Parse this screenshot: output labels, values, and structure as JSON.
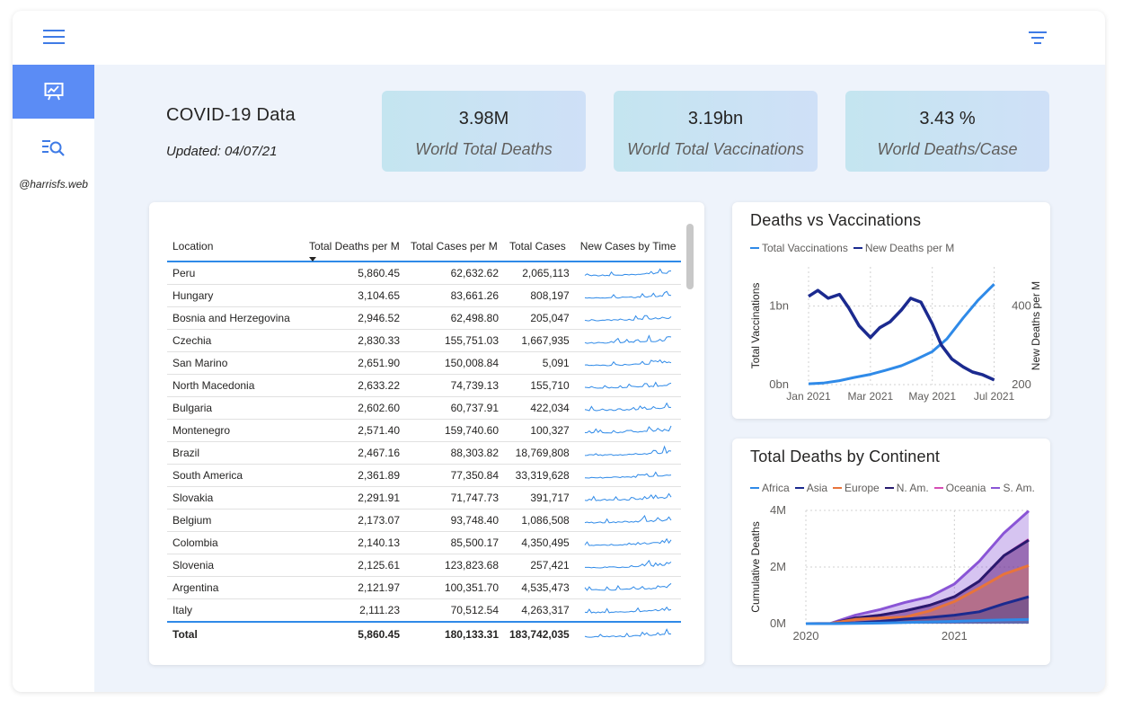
{
  "sidebar": {
    "handle": "@harrisfs.web"
  },
  "header": {
    "title": "COVID-19 Data",
    "updated": "Updated: 04/07/21"
  },
  "kpis": [
    {
      "value": "3.98M",
      "label": "World Total Deaths"
    },
    {
      "value": "3.19bn",
      "label": "World Total Vaccinations"
    },
    {
      "value": "3.43 %",
      "label": "World Deaths/Case"
    }
  ],
  "table": {
    "headers": [
      "Location",
      "Total Deaths per M",
      "Total Cases per M",
      "Total Cases",
      "New Cases by Time"
    ],
    "rows": [
      {
        "location": "Peru",
        "deaths_per_m": "5,860.45",
        "cases_per_m": "62,632.62",
        "total_cases": "2,065,113"
      },
      {
        "location": "Hungary",
        "deaths_per_m": "3,104.65",
        "cases_per_m": "83,661.26",
        "total_cases": "808,197"
      },
      {
        "location": "Bosnia and Herzegovina",
        "deaths_per_m": "2,946.52",
        "cases_per_m": "62,498.80",
        "total_cases": "205,047"
      },
      {
        "location": "Czechia",
        "deaths_per_m": "2,830.33",
        "cases_per_m": "155,751.03",
        "total_cases": "1,667,935"
      },
      {
        "location": "San Marino",
        "deaths_per_m": "2,651.90",
        "cases_per_m": "150,008.84",
        "total_cases": "5,091"
      },
      {
        "location": "North Macedonia",
        "deaths_per_m": "2,633.22",
        "cases_per_m": "74,739.13",
        "total_cases": "155,710"
      },
      {
        "location": "Bulgaria",
        "deaths_per_m": "2,602.60",
        "cases_per_m": "60,737.91",
        "total_cases": "422,034"
      },
      {
        "location": "Montenegro",
        "deaths_per_m": "2,571.40",
        "cases_per_m": "159,740.60",
        "total_cases": "100,327"
      },
      {
        "location": "Brazil",
        "deaths_per_m": "2,467.16",
        "cases_per_m": "88,303.82",
        "total_cases": "18,769,808"
      },
      {
        "location": "South America",
        "deaths_per_m": "2,361.89",
        "cases_per_m": "77,350.84",
        "total_cases": "33,319,628"
      },
      {
        "location": "Slovakia",
        "deaths_per_m": "2,291.91",
        "cases_per_m": "71,747.73",
        "total_cases": "391,717"
      },
      {
        "location": "Belgium",
        "deaths_per_m": "2,173.07",
        "cases_per_m": "93,748.40",
        "total_cases": "1,086,508"
      },
      {
        "location": "Colombia",
        "deaths_per_m": "2,140.13",
        "cases_per_m": "85,500.17",
        "total_cases": "4,350,495"
      },
      {
        "location": "Slovenia",
        "deaths_per_m": "2,125.61",
        "cases_per_m": "123,823.68",
        "total_cases": "257,421"
      },
      {
        "location": "Argentina",
        "deaths_per_m": "2,121.97",
        "cases_per_m": "100,351.70",
        "total_cases": "4,535,473"
      },
      {
        "location": "Italy",
        "deaths_per_m": "2,111.23",
        "cases_per_m": "70,512.54",
        "total_cases": "4,263,317"
      }
    ],
    "total": {
      "label": "Total",
      "deaths_per_m": "5,860.45",
      "cases_per_m": "180,133.31",
      "total_cases": "183,742,035"
    },
    "sparkline_color": "#2f8ae8"
  },
  "chart_data": [
    {
      "type": "line",
      "title": "Deaths vs Vaccinations",
      "series": [
        {
          "name": "Total Vaccinations",
          "color": "#2f8ae8",
          "axis": "left",
          "unit": "bn",
          "x": [
            "2021-01-01",
            "2021-01-15",
            "2021-02-01",
            "2021-02-15",
            "2021-03-01",
            "2021-03-15",
            "2021-04-01",
            "2021-04-15",
            "2021-05-01",
            "2021-05-15",
            "2021-06-01",
            "2021-06-15",
            "2021-07-01"
          ],
          "values": [
            0.01,
            0.02,
            0.05,
            0.09,
            0.13,
            0.18,
            0.24,
            0.32,
            0.42,
            0.58,
            0.85,
            1.07,
            1.28
          ]
        },
        {
          "name": "New Deaths per M",
          "color": "#1b2a8f",
          "axis": "right",
          "x": [
            "2021-01-01",
            "2021-01-10",
            "2021-01-20",
            "2021-02-01",
            "2021-02-10",
            "2021-02-20",
            "2021-03-01",
            "2021-03-10",
            "2021-03-20",
            "2021-04-01",
            "2021-04-10",
            "2021-04-20",
            "2021-05-01",
            "2021-05-10",
            "2021-05-20",
            "2021-06-01",
            "2021-06-10",
            "2021-06-20",
            "2021-07-01"
          ],
          "values": [
            425,
            440,
            420,
            430,
            395,
            350,
            320,
            345,
            360,
            390,
            420,
            410,
            355,
            300,
            265,
            245,
            232,
            225,
            212
          ]
        }
      ],
      "x_ticks": [
        "Jan 2021",
        "Mar 2021",
        "May 2021",
        "Jul 2021"
      ],
      "legend": [
        "Total Vaccinations",
        "New Deaths per M"
      ],
      "ylabel_left": "Total Vaccinations",
      "ylabel_right": "New Deaths per M",
      "ylim_left": [
        0,
        1.5
      ],
      "yticks_left": [
        "0bn",
        "1bn"
      ],
      "ylim_right": [
        200,
        500
      ],
      "yticks_right": [
        "200",
        "400"
      ],
      "legend_position": "top-left",
      "grid": true
    },
    {
      "type": "area",
      "title": "Total Deaths by Continent",
      "x": [
        "2020-01",
        "2020-03",
        "2020-05",
        "2020-07",
        "2020-09",
        "2020-11",
        "2021-01",
        "2021-03",
        "2021-05",
        "2021-07"
      ],
      "series": [
        {
          "name": "Africa",
          "color": "#2f8ae8",
          "values": [
            0,
            0,
            0.005,
            0.02,
            0.04,
            0.06,
            0.08,
            0.11,
            0.13,
            0.15
          ]
        },
        {
          "name": "Asia",
          "color": "#1b2a8f",
          "values": [
            0,
            0,
            0.03,
            0.08,
            0.16,
            0.22,
            0.3,
            0.42,
            0.7,
            0.95
          ]
        },
        {
          "name": "Europe",
          "color": "#e8743b",
          "values": [
            0,
            0.01,
            0.15,
            0.2,
            0.23,
            0.45,
            0.78,
            1.25,
            1.75,
            2.05
          ]
        },
        {
          "name": "N. Am.",
          "color": "#281a6e",
          "values": [
            0,
            0,
            0.2,
            0.3,
            0.45,
            0.65,
            0.95,
            1.5,
            2.4,
            2.95
          ]
        },
        {
          "name": "Oceania",
          "color": "#d64db5",
          "values": [
            0,
            0,
            0.2,
            0.3,
            0.45,
            0.65,
            0.95,
            1.5,
            2.4,
            2.97
          ]
        },
        {
          "name": "S. Am.",
          "color": "#8a55d6",
          "values": [
            0,
            0.01,
            0.3,
            0.5,
            0.75,
            0.95,
            1.4,
            2.2,
            3.2,
            3.98
          ]
        }
      ],
      "ylabel": "Cumulative Deaths",
      "ylim": [
        0,
        4
      ],
      "yticks": [
        "0M",
        "2M",
        "4M"
      ],
      "x_ticks": [
        "2020",
        "2021"
      ],
      "legend_position": "top",
      "grid": true
    }
  ]
}
